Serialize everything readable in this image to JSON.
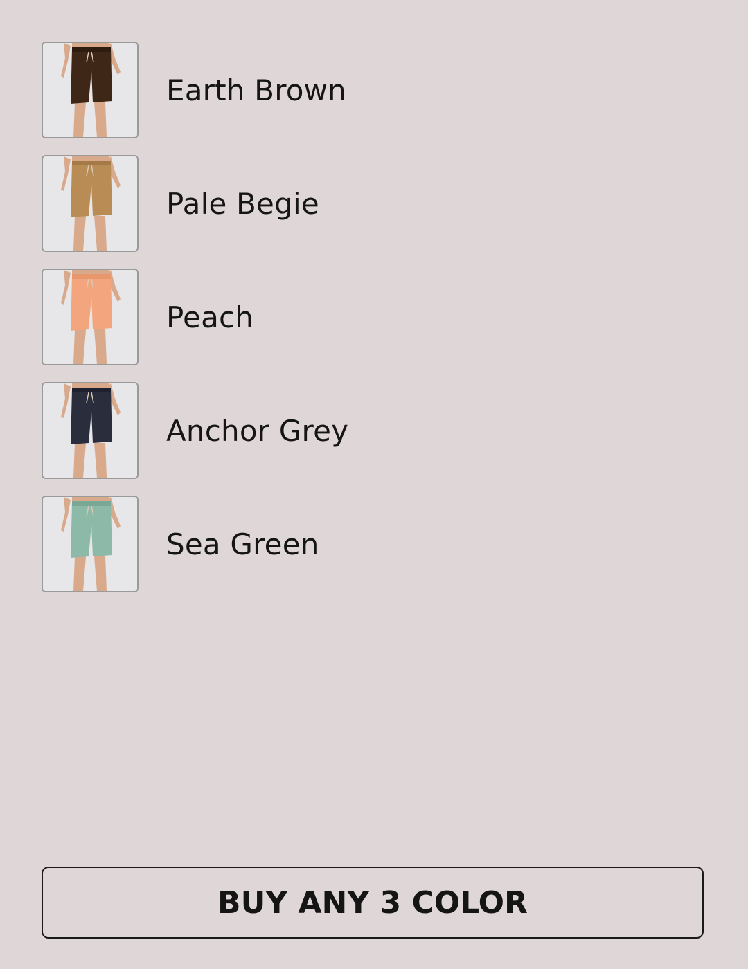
{
  "colors": [
    {
      "label": "Earth Brown",
      "swatch": "#3f2717",
      "waistband": "#2f1c10",
      "icon": "shorts-icon"
    },
    {
      "label": "Pale Begie",
      "swatch": "#b98c56",
      "waistband": "#a67a46",
      "icon": "shorts-icon"
    },
    {
      "label": "Peach",
      "swatch": "#f3a67d",
      "waistband": "#e8966b",
      "icon": "shorts-icon"
    },
    {
      "label": "Anchor Grey",
      "swatch": "#2a2d3b",
      "waistband": "#1f222e",
      "icon": "shorts-icon"
    },
    {
      "label": "Sea Green",
      "swatch": "#8cb9a8",
      "waistband": "#7aa896",
      "icon": "shorts-icon"
    }
  ],
  "cta": {
    "label": "BUY ANY 3 COLOR"
  },
  "theme": {
    "background": "#dfd7d7",
    "text": "#151515",
    "skin": "#d9a98c"
  }
}
